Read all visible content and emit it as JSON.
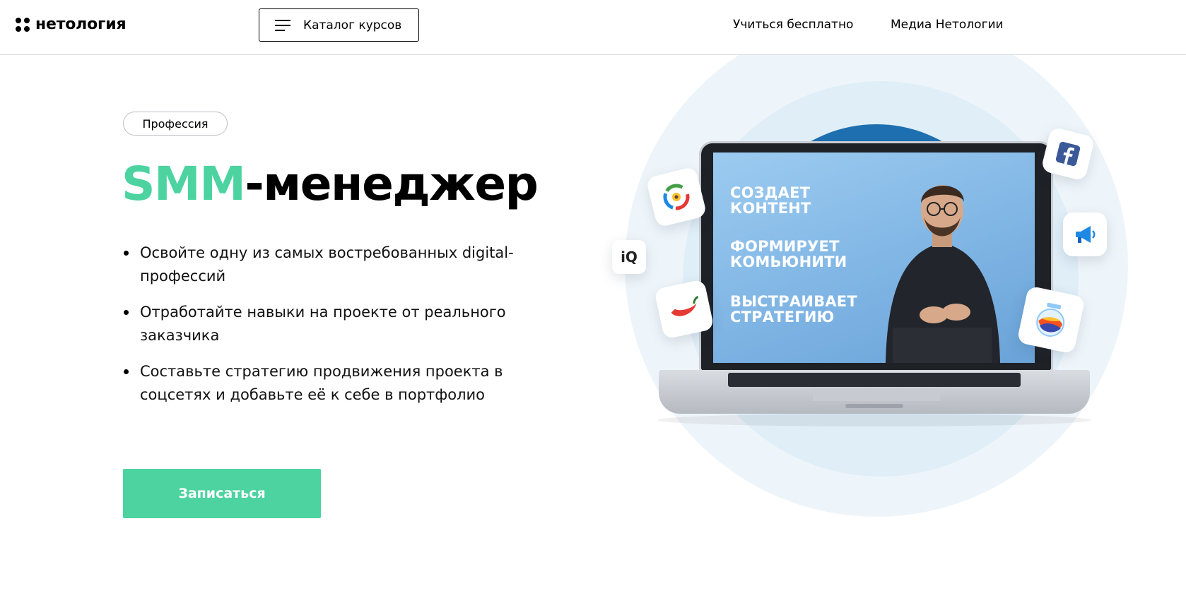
{
  "header": {
    "logo_text": "нетология",
    "catalog_label": "Каталог курсов",
    "nav": [
      "Учиться бесплатно",
      "Медиа Нетологии"
    ]
  },
  "hero": {
    "badge": "Профессия",
    "title_accent": "SMM",
    "title_rest": "-менеджер",
    "bullets": [
      "Освойте одну из самых востребованных digital-профессий",
      "Отработайте навыки на проекте от реального заказчика",
      "Составьте стратегию продвижения проекта в соцсетях и добавьте её к себе в портфолио"
    ],
    "cta_label": "Записаться"
  },
  "laptop_screen": {
    "line1": "СОЗДАЕТ\nКОНТЕНТ",
    "line2": "ФОРМИРУЕТ\nКОМЬЮНИТИ",
    "line3": "ВЫСТРАИВАЕТ\nСТРАТЕГИЮ"
  },
  "app_icons": {
    "iq_label": "iQ",
    "icons": [
      "target-logo-icon",
      "iq-logo-icon",
      "chili-pepper-icon",
      "facebook-icon",
      "megaphone-icon",
      "fish-jar-icon"
    ]
  },
  "colors": {
    "accent": "#4cd3a0",
    "brand_blue": "#1d6fb0",
    "facebook": "#3b5998"
  }
}
